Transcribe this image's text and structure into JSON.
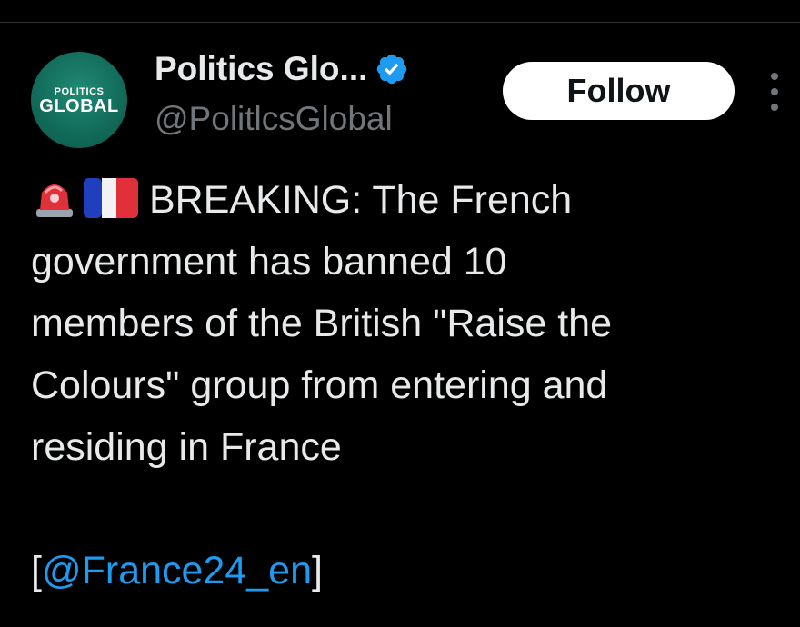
{
  "author": {
    "avatar_text_top": "POLITICS",
    "avatar_text_bottom": "GLOBAL",
    "display_name": "Politics Glo...",
    "handle": "@PolitlcsGlobal",
    "verified": true
  },
  "actions": {
    "follow_label": "Follow"
  },
  "tweet": {
    "lines": [
      "BREAKING: The French",
      "government has banned 10",
      "members of the British \"Raise the",
      "Colours\" group from entering and",
      "residing in France"
    ],
    "bracket_open": "[",
    "mention": "@France24_en",
    "bracket_close": "]"
  },
  "colors": {
    "background": "#000000",
    "text": "#e7e9ea",
    "secondary": "#71767b",
    "accent": "#1d9bf0",
    "avatar_bg": "#126a59",
    "follow_bg": "#ffffff"
  },
  "icons": [
    "rotating-light-icon",
    "france-flag-icon",
    "verified-badge-icon",
    "more-options-icon"
  ]
}
